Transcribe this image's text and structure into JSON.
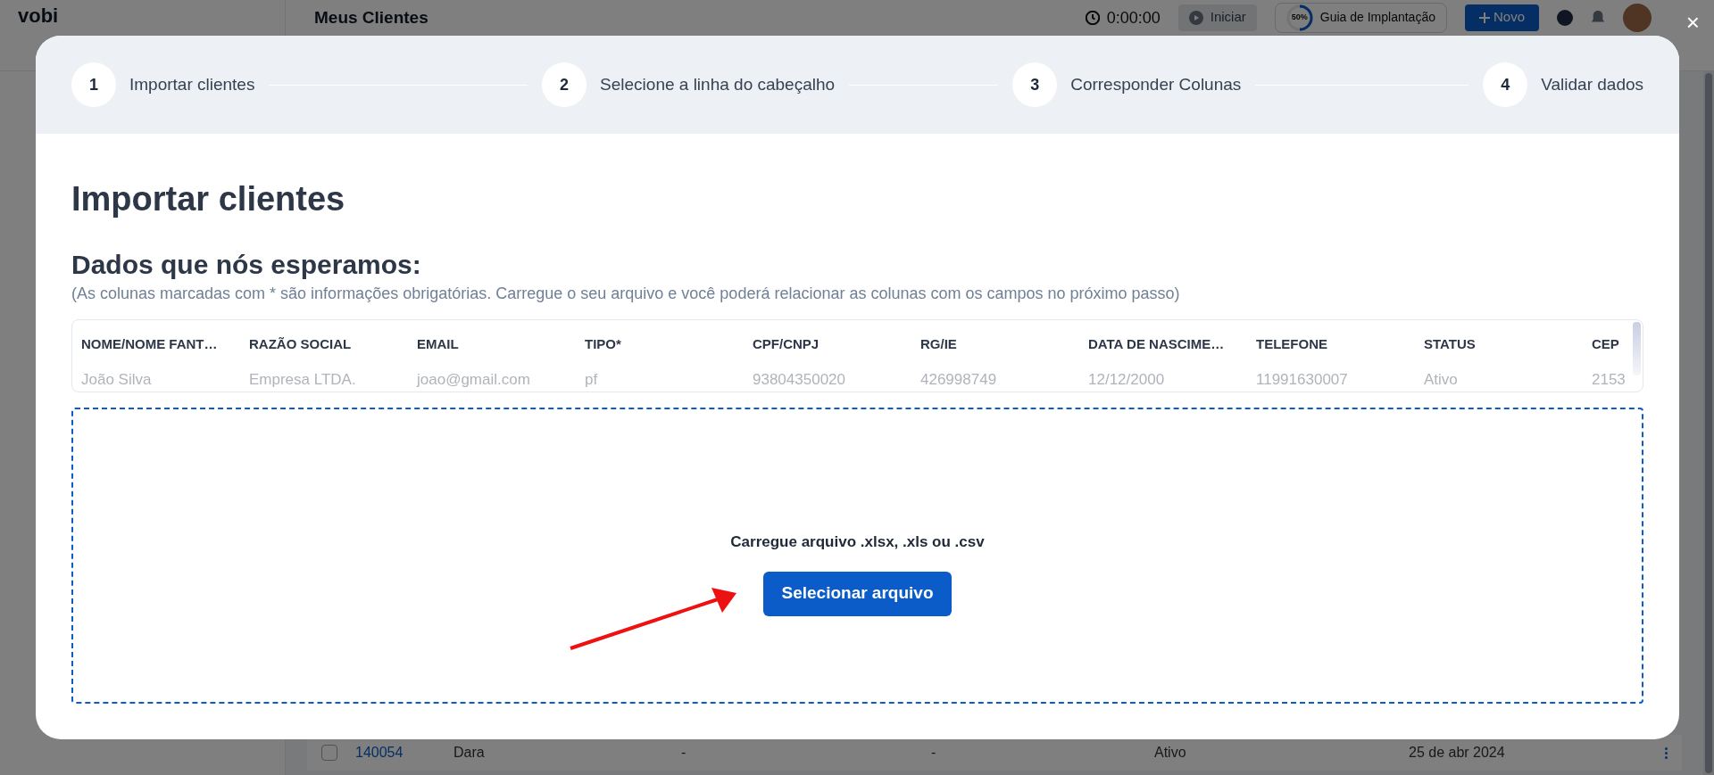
{
  "background": {
    "logo": "vobi",
    "page_title": "Meus Clientes",
    "timer": "0:00:00",
    "start_button": "Iniciar",
    "guide": {
      "percent": "50%",
      "label": "Guia de Implantação",
      "level": 0.5
    },
    "new_button": "Novo",
    "row": {
      "checked": false,
      "id": "140054",
      "name": "Dara",
      "column_3": "-",
      "column_4": "-",
      "status": "Ativo",
      "date": "25 de abr 2024"
    }
  },
  "modal": {
    "close": "×",
    "steps": [
      {
        "number": "1",
        "label": "Importar clientes"
      },
      {
        "number": "2",
        "label": "Selecione a linha do cabeçalho"
      },
      {
        "number": "3",
        "label": "Corresponder Colunas"
      },
      {
        "number": "4",
        "label": "Validar dados"
      }
    ],
    "title": "Importar clientes",
    "subtitle": "Dados que nós esperamos:",
    "hint": "(As colunas marcadas com * são informações obrigatórias. Carregue o seu arquivo e você poderá relacionar as colunas com os campos no próximo passo)",
    "table": {
      "columns": [
        "NOME/NOME FANT…",
        "RAZÃO SOCIAL",
        "EMAIL",
        "TIPO*",
        "CPF/CNPJ",
        "RG/IE",
        "DATA DE NASCIME…",
        "TELEFONE",
        "STATUS",
        "CEP"
      ],
      "row": [
        "João Silva",
        "Empresa LTDA.",
        "joao@gmail.com",
        "pf",
        "93804350020",
        "426998749",
        "12/12/2000",
        "11991630007",
        "Ativo",
        "2153"
      ]
    },
    "dropzone": {
      "text": "Carregue arquivo .xlsx, .xls ou .csv",
      "button": "Selecionar arquivo"
    }
  }
}
